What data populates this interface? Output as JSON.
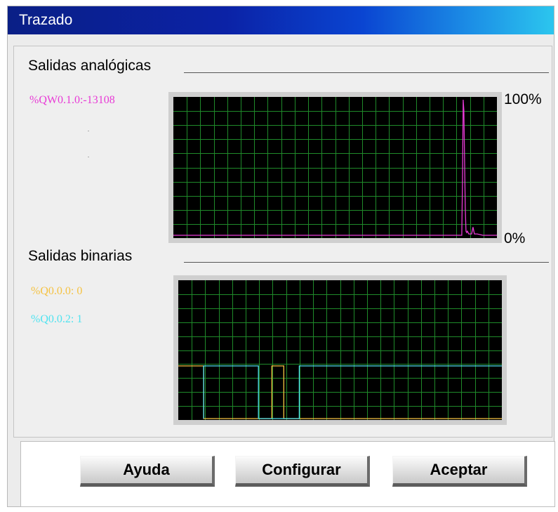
{
  "window": {
    "title": "Trazado"
  },
  "analog": {
    "section_title": "Salidas analógicas",
    "legend": [
      {
        "label": "%QW0.1.0:-13108",
        "color": "#e83ad6"
      }
    ],
    "scale_max": "100%",
    "scale_min": "0%"
  },
  "binary": {
    "section_title": "Salidas binarias",
    "legend": [
      {
        "label": "%Q0.0.0:  0",
        "color": "#f5c242"
      },
      {
        "label": "%Q0.0.2:  1",
        "color": "#4fe3f0"
      }
    ]
  },
  "chart_data": [
    {
      "type": "line",
      "ylim": [
        0,
        100
      ],
      "grid": true,
      "series": [
        {
          "name": "%QW0.1.0",
          "color": "#e83ad6",
          "x": [
            0,
            410,
            411,
            412,
            413,
            414,
            415,
            416,
            417,
            418,
            420,
            424,
            426,
            428,
            430,
            432,
            440,
            460
          ],
          "y": [
            0,
            0,
            40,
            100,
            92,
            55,
            20,
            3,
            2,
            3,
            1,
            1,
            6,
            1,
            1,
            1,
            0,
            0
          ]
        }
      ]
    },
    {
      "type": "line",
      "ylim": [
        0,
        1
      ],
      "grid": true,
      "series": [
        {
          "name": "%Q0.0.0",
          "color": "#f5c242",
          "x": [
            0,
            36,
            36,
            133,
            133,
            150,
            150,
            460
          ],
          "y": [
            1,
            1,
            0,
            0,
            1,
            1,
            0,
            0
          ]
        },
        {
          "name": "%Q0.0.2",
          "color": "#4fe3f0",
          "x": [
            36,
            36,
            114,
            114,
            172,
            172,
            460
          ],
          "y": [
            0,
            1,
            1,
            0,
            0,
            1,
            1
          ]
        }
      ]
    }
  ],
  "buttons": {
    "help": "Ayuda",
    "configure": "Configurar",
    "accept": "Aceptar"
  }
}
